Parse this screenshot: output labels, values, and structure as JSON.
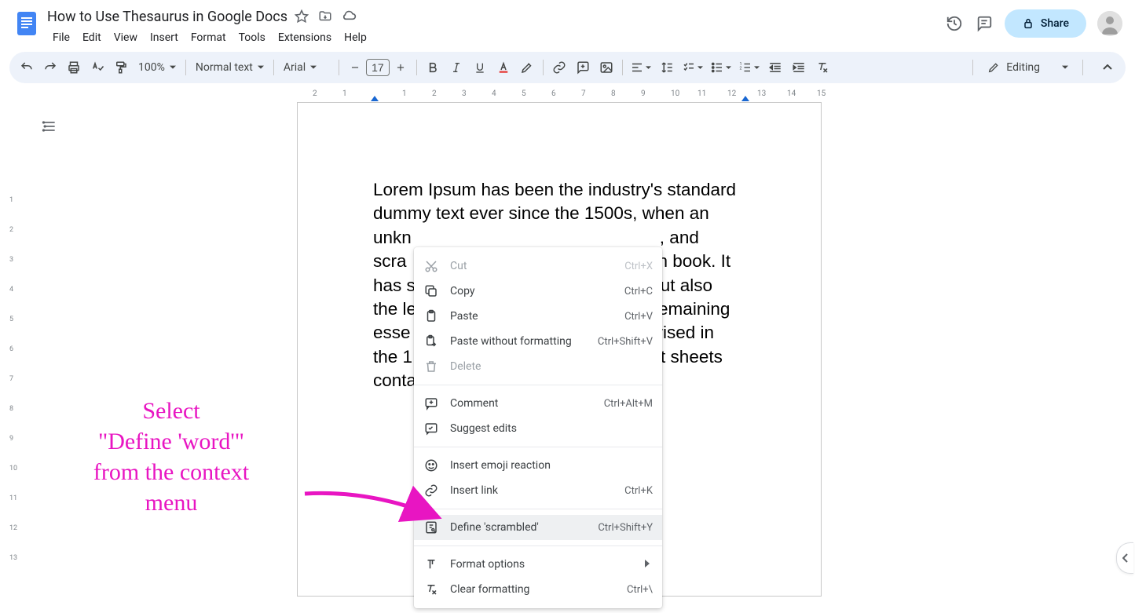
{
  "header": {
    "doc_title": "How to Use Thesaurus in Google Docs",
    "share_label": "Share"
  },
  "menubar": [
    "File",
    "Edit",
    "View",
    "Insert",
    "Format",
    "Tools",
    "Extensions",
    "Help"
  ],
  "toolbar": {
    "zoom": "100%",
    "style": "Normal text",
    "font": "Arial",
    "font_size": "17",
    "editing_label": "Editing"
  },
  "ruler_numbers_h": [
    "2",
    "1",
    "1",
    "2",
    "3",
    "4",
    "5",
    "6",
    "7",
    "8",
    "9",
    "10",
    "11",
    "12",
    "13",
    "14",
    "15"
  ],
  "ruler_positions_h": [
    20,
    58,
    134,
    172,
    210,
    248,
    286,
    324,
    362,
    400,
    438,
    476,
    510,
    548,
    586,
    624,
    662
  ],
  "ruler_numbers_v": [
    "1",
    "2",
    "3",
    "4",
    "5",
    "6",
    "7",
    "8",
    "9",
    "10",
    "11",
    "12",
    "13"
  ],
  "document": {
    "line1": "Lorem Ipsum has been the industry's standard",
    "line2": "dummy text ever since the 1500s, when an",
    "line3_a": "unkn",
    "line3_b": ", and",
    "line4_a": "scra",
    "line4_b": "n book. It",
    "line5_a": "has s",
    "line5_b": "ut also",
    "line6_a": "the le",
    "line6_b": "emaining",
    "line7_a": "esse",
    "line7_b": "rised in",
    "line8_a": "the 1",
    "line8_b": "t sheets",
    "line9_a": "conta"
  },
  "context_menu": [
    {
      "icon": "cut",
      "label": "Cut",
      "shortcut": "Ctrl+X",
      "disabled": true
    },
    {
      "icon": "copy",
      "label": "Copy",
      "shortcut": "Ctrl+C"
    },
    {
      "icon": "paste",
      "label": "Paste",
      "shortcut": "Ctrl+V"
    },
    {
      "icon": "paste-plain",
      "label": "Paste without formatting",
      "shortcut": "Ctrl+Shift+V"
    },
    {
      "icon": "delete",
      "label": "Delete",
      "shortcut": "",
      "disabled": true
    },
    {
      "sep": true
    },
    {
      "icon": "comment",
      "label": "Comment",
      "shortcut": "Ctrl+Alt+M"
    },
    {
      "icon": "suggest",
      "label": "Suggest edits",
      "shortcut": ""
    },
    {
      "sep": true
    },
    {
      "icon": "emoji",
      "label": "Insert emoji reaction",
      "shortcut": ""
    },
    {
      "icon": "link",
      "label": "Insert link",
      "shortcut": "Ctrl+K"
    },
    {
      "sep": true
    },
    {
      "icon": "define",
      "label": "Define 'scrambled'",
      "shortcut": "Ctrl+Shift+Y",
      "highlighted": true
    },
    {
      "sep": true
    },
    {
      "icon": "format",
      "label": "Format options",
      "shortcut": "",
      "submenu": true
    },
    {
      "icon": "clear",
      "label": "Clear formatting",
      "shortcut": "Ctrl+\\"
    }
  ],
  "annotation": {
    "line1": "Select",
    "line2": "\"Define 'word'\"",
    "line3": "from the context",
    "line4": "menu"
  }
}
